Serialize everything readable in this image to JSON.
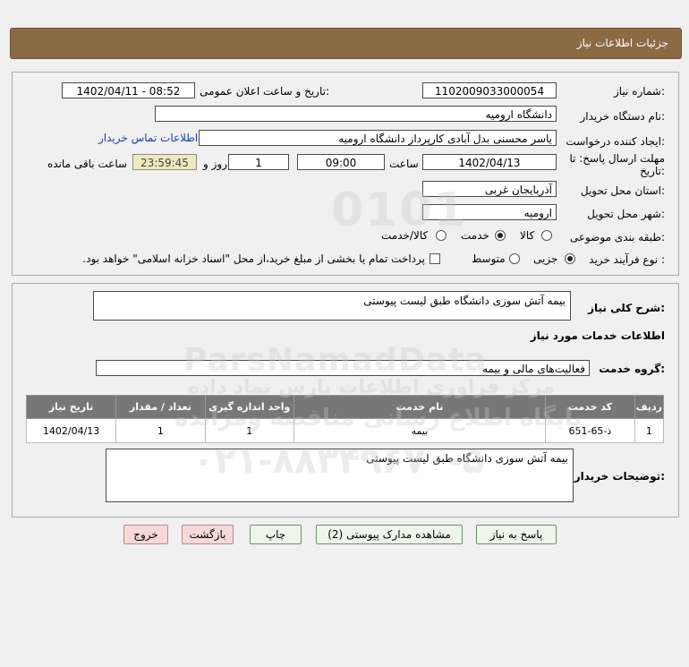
{
  "header": {
    "title": "جزئیات اطلاعات نیاز"
  },
  "form": {
    "need_number_label": "شماره نیاز:",
    "need_number": "1102009033000054",
    "announce_label": "تاریخ و ساعت اعلان عمومی:",
    "announce_value": "1402/04/11 - 08:52",
    "buyer_org_label": "نام دستگاه خریدار:",
    "buyer_org": "دانشگاه ارومیه",
    "requester_label": "ایجاد کننده درخواست:",
    "requester": "یاسر محسنی بدل آبادی کارپرداز دانشگاه ارومیه",
    "contact_link": "اطلاعات تماس خریدار",
    "deadline_label_1": "مهلت ارسال پاسخ: تا",
    "deadline_label_2": "تاریخ:",
    "deadline_date": "1402/04/13",
    "time_label": "ساعت",
    "deadline_time": "09:00",
    "days_value": "1",
    "days_label": "روز و",
    "remaining_time": "23:59:45",
    "remaining_label": "ساعت باقی مانده",
    "province_label": "استان محل تحویل:",
    "province": "آذربایجان غربی",
    "city_label": "شهر محل تحویل:",
    "city": "ارومیه",
    "category_label": "طبقه بندی موضوعی:",
    "category_options": [
      "کالا",
      "خدمت",
      "کالا/خدمت"
    ],
    "category_selected": "خدمت",
    "process_label": "نوع فرآیند خرید :",
    "process_options": [
      "جزیی",
      "متوسط"
    ],
    "process_selected": "جزیی",
    "treasury_note": "پرداخت تمام یا بخشی از مبلغ خرید،از محل \"اسناد خزانه اسلامی\" خواهد بود."
  },
  "summary": {
    "label": "شرح کلی نیاز:",
    "value": "بیمه آتش سوزی دانشگاه طبق لیست پیوستی",
    "services_heading": "اطلاعات خدمات مورد نیاز",
    "service_group_label": "گروه خدمت:",
    "service_group": "فعالیت‌های مالی و بیمه"
  },
  "table": {
    "headers": [
      "ردیف",
      "کد خدمت",
      "نام خدمت",
      "واحد اندازه گیری",
      "تعداد / مقدار",
      "تاریخ نیاز"
    ],
    "rows": [
      [
        "1",
        "ذ-65-651",
        "بیمه",
        "1",
        "1",
        "1402/04/13"
      ]
    ]
  },
  "buyer_notes": {
    "label": "توضیحات خریدار:",
    "value": "بیمه آتش سوزی دانشگاه طبق لیست پیوستی"
  },
  "buttons": {
    "reply": "پاسخ به نیاز",
    "attachments": "مشاهده مدارک پیوستی (2)",
    "print": "چاپ",
    "back": "بازگشت",
    "exit": "خروج"
  },
  "watermark": {
    "brand": "ParsNamadData",
    "line1": "مرکز فراوری اطلاعات پارس نماد داده",
    "line2": "پایگاه اطلاع رسانی مناقصه ومزایده",
    "phone": "۰۲۱-۸۸۳۴۹۶۷۰-۵"
  }
}
